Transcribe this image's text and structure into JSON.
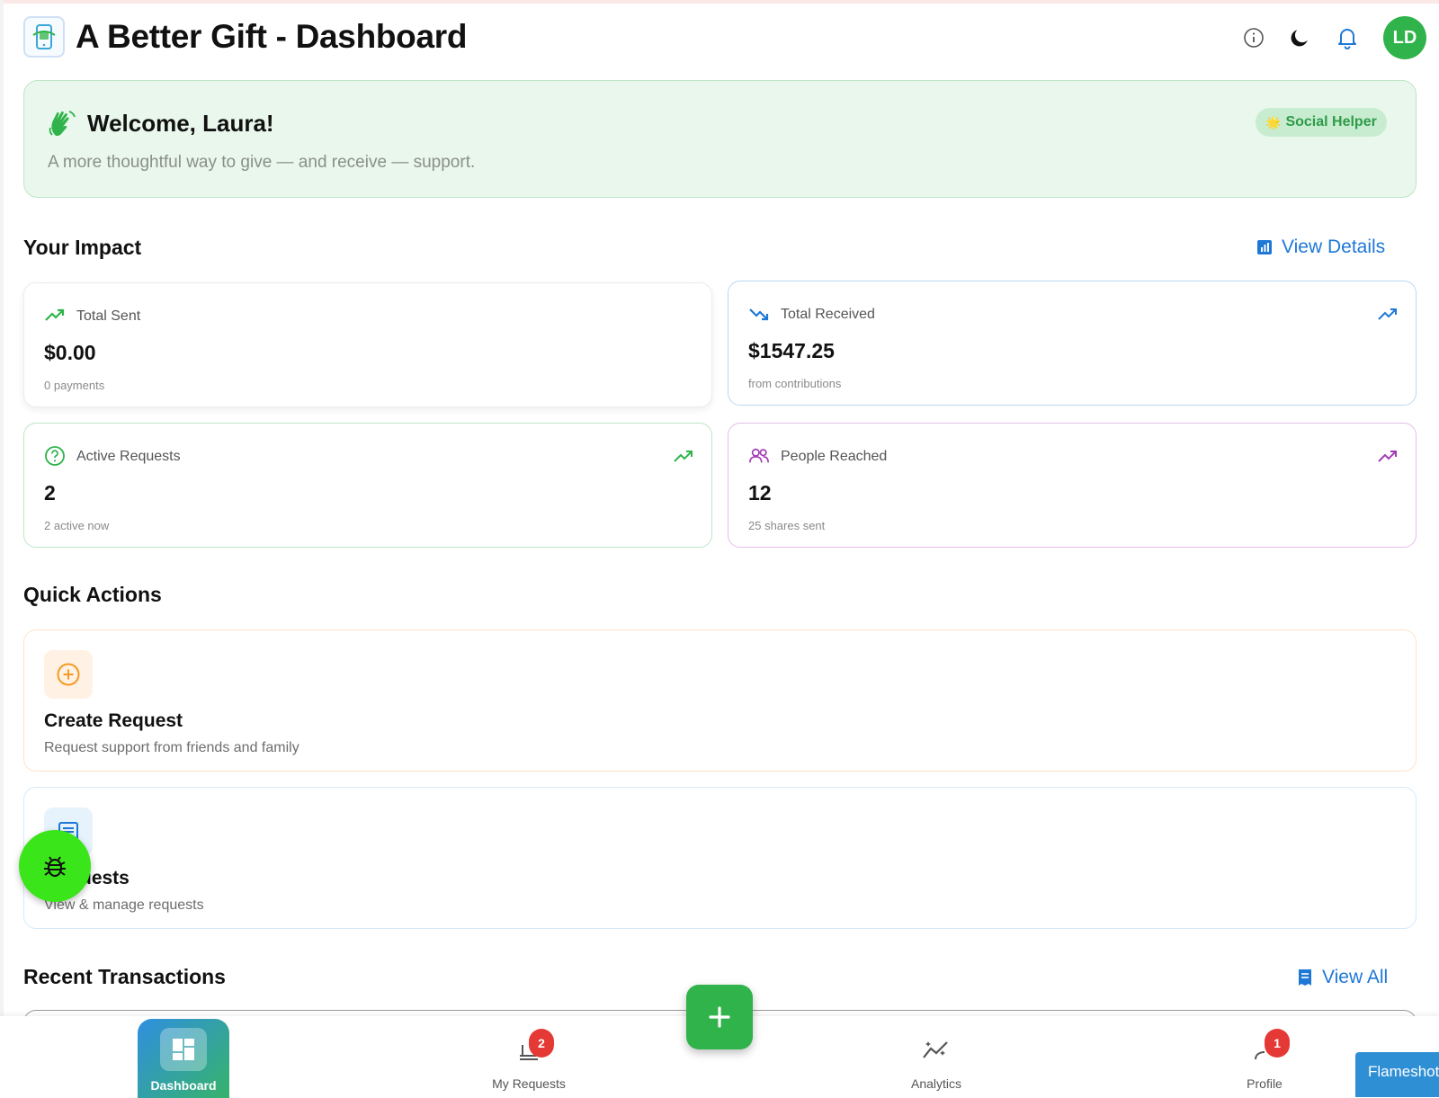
{
  "header": {
    "title": "A Better Gift - Dashboard",
    "avatar_initials": "LD",
    "icons": [
      "info-icon",
      "moon-icon",
      "bell-icon"
    ]
  },
  "welcome": {
    "title": "Welcome, Laura!",
    "subtitle": "A more thoughtful way to give — and receive — support.",
    "badge_emoji": "🌟",
    "badge_label": "Social Helper"
  },
  "impact": {
    "title": "Your Impact",
    "view_details_label": "View Details",
    "stats": [
      {
        "label": "Total Sent",
        "value": "$0.00",
        "sub": "0 payments",
        "color": "#2fb34a"
      },
      {
        "label": "Total Received",
        "value": "$1547.25",
        "sub": "from contributions",
        "color": "#1e78d6"
      },
      {
        "label": "Active Requests",
        "value": "2",
        "sub": "2 active now",
        "color": "#2fb34a"
      },
      {
        "label": "People Reached",
        "value": "12",
        "sub": "25 shares sent",
        "color": "#a23ab5"
      }
    ]
  },
  "quick_actions": {
    "title": "Quick Actions",
    "items": [
      {
        "title": "Create Request",
        "sub": "Request support from friends and family",
        "color": "#f59a23"
      },
      {
        "title": "uests",
        "sub": "View & manage requests",
        "color": "#1e78d6"
      }
    ]
  },
  "transactions": {
    "title": "Recent Transactions",
    "view_all_label": "View All"
  },
  "bottom_nav": {
    "items": [
      {
        "label": "Dashboard",
        "active": true
      },
      {
        "label": "My Requests",
        "badge": "2"
      },
      {
        "label": "Analytics"
      },
      {
        "label": "Profile",
        "badge": "1"
      }
    ],
    "fab_icon": "plus-icon"
  },
  "overlay": {
    "flameshot_label": "Flameshot"
  },
  "colors": {
    "primary_green": "#2fb34a",
    "primary_blue": "#1e78d6",
    "bug_button": "#3ae51a",
    "badge_red": "#e53935"
  }
}
